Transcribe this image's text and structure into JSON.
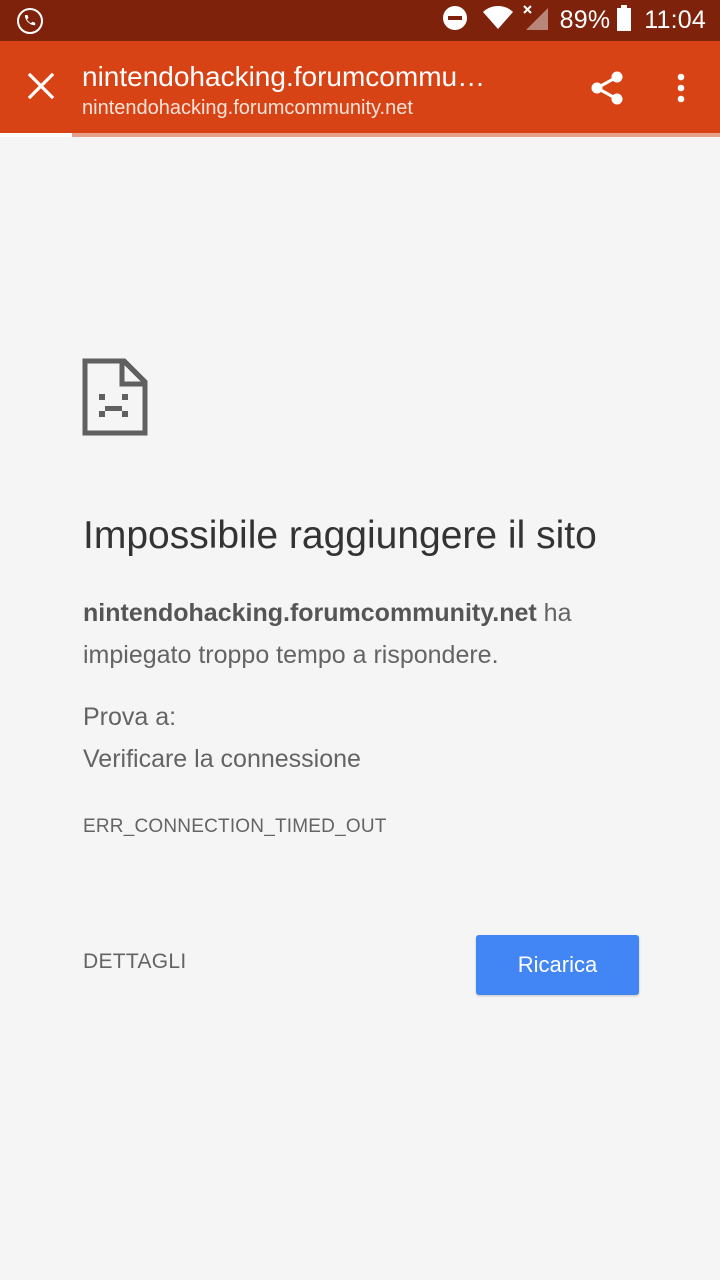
{
  "status_bar": {
    "left_icon": "phone-call-icon",
    "icons": [
      "do-not-disturb-icon",
      "wifi-icon",
      "no-signal-icon",
      "battery-icon"
    ],
    "battery": "89%",
    "time": "11:04"
  },
  "toolbar": {
    "close_icon": "close-icon",
    "title": "nintendohacking.forumcommunity.net",
    "url": "nintendohacking.forumcommunity.net",
    "share_icon": "share-icon",
    "menu_icon": "more-vert-icon",
    "colors": {
      "background": "#d84315",
      "status_bar": "#7e220b"
    }
  },
  "page_load_progress": 0.1,
  "error_page": {
    "icon": "sad-page-icon",
    "title": "Impossibile raggiungere il sito",
    "domain": "nintendohacking.forumcommunity.net",
    "message_suffix": " ha impiegato troppo tempo a rispondere.",
    "suggestions_heading": "Prova a:",
    "suggestions": [
      "Verificare la connessione"
    ],
    "error_code": "ERR_CONNECTION_TIMED_OUT",
    "details_label": "DETTAGLI",
    "reload_label": "Ricarica",
    "reload_color": "#4285f4"
  }
}
